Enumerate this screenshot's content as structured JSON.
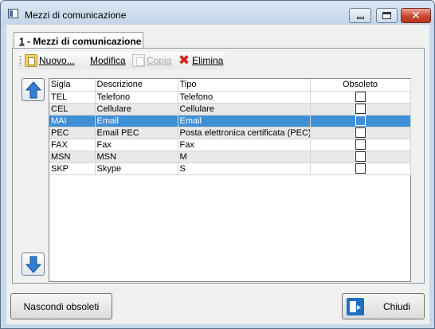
{
  "window": {
    "title": "Mezzi di comunicazione"
  },
  "tab": {
    "shortcut": "1",
    "label": " - Mezzi di comunicazione"
  },
  "toolbar": {
    "new_label": "Nuovo...",
    "edit_label": "Modifica",
    "copy_label": "Copia",
    "delete_label": "Elimina"
  },
  "grid": {
    "columns": [
      "Sigla",
      "Descrizione",
      "Tipo",
      "Obsoleto"
    ],
    "rows": [
      {
        "sigla": "TEL",
        "descrizione": "Telefono",
        "tipo": "Telefono",
        "obsoleto": false
      },
      {
        "sigla": "CEL",
        "descrizione": "Cellulare",
        "tipo": "Cellulare",
        "obsoleto": false
      },
      {
        "sigla": "MAI",
        "descrizione": "Email",
        "tipo": "Email",
        "obsoleto": false
      },
      {
        "sigla": "PEC",
        "descrizione": "Email PEC",
        "tipo": "Posta elettronica certificata (PEC)",
        "obsoleto": false
      },
      {
        "sigla": "FAX",
        "descrizione": "Fax",
        "tipo": "Fax",
        "obsoleto": false
      },
      {
        "sigla": "MSN",
        "descrizione": "MSN",
        "tipo": "M",
        "obsoleto": false
      },
      {
        "sigla": "SKP",
        "descrizione": "Skype",
        "tipo": "S",
        "obsoleto": false
      }
    ],
    "selected_row": 2
  },
  "buttons": {
    "hide_obsolete": "Nascondi obsoleti",
    "close": "Chiudi"
  },
  "colors": {
    "selection": "#3f8fd6",
    "window_frame": "#c9d9ea",
    "close_button": "#c7452f",
    "arrow_blue": "#2f7fd2"
  }
}
